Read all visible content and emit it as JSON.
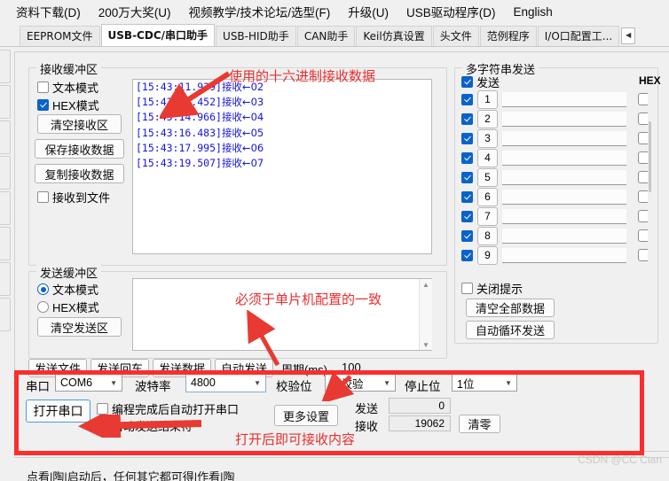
{
  "menubar": {
    "items": [
      {
        "label": "资料下载(D)",
        "accel": "D"
      },
      {
        "label": "200万大奖(U)",
        "accel": "U"
      },
      {
        "label": "视频教学/技术论坛/选型(F)",
        "accel": "F"
      },
      {
        "label": "升级(U)",
        "accel": "U"
      },
      {
        "label": "USB驱动程序(D)",
        "accel": "D"
      },
      {
        "label": "English",
        "accel": "E"
      }
    ]
  },
  "tabs": {
    "items": [
      {
        "label": "EEPROM文件",
        "active": false
      },
      {
        "label": "USB-CDC/串口助手",
        "active": true
      },
      {
        "label": "USB-HID助手",
        "active": false
      },
      {
        "label": "CAN助手",
        "active": false
      },
      {
        "label": "Keil仿真设置",
        "active": false
      },
      {
        "label": "头文件",
        "active": false
      },
      {
        "label": "范例程序",
        "active": false
      },
      {
        "label": "I/O口配置工...",
        "active": false
      }
    ],
    "overflow_arrow": "◀"
  },
  "receive_group": {
    "title": "接收缓冲区",
    "text_mode_label": "文本模式",
    "text_mode_checked": false,
    "hex_mode_label": "HEX模式",
    "hex_mode_checked": true,
    "clear_button": "清空接收区",
    "save_button": "保存接收数据",
    "copy_button": "复制接收数据",
    "to_file_label": "接收到文件",
    "to_file_checked": false,
    "log_lines": [
      {
        "ts": "[15:43:11.939]",
        "text": "接收←02"
      },
      {
        "ts": "[15:43:13.452]",
        "text": "接收←03"
      },
      {
        "ts": "[15:43:14.966]",
        "text": "接收←04"
      },
      {
        "ts": "[15:43:16.483]",
        "text": "接收←05"
      },
      {
        "ts": "[15:43:17.995]",
        "text": "接收←06"
      },
      {
        "ts": "[15:43:19.507]",
        "text": "接收←07"
      }
    ]
  },
  "send_group": {
    "title": "发送缓冲区",
    "text_mode_label": "文本模式",
    "text_mode_checked": true,
    "hex_mode_label": "HEX模式",
    "hex_mode_checked": false,
    "clear_button": "清空发送区",
    "send_value": "",
    "buttons": [
      "发送文件",
      "发送回车",
      "发送数据",
      "自动发送"
    ],
    "period_label": "周期(ms)",
    "period_value": "100"
  },
  "multi_send": {
    "title": "多字符串发送",
    "send_header": "发送",
    "hex_header": "HEX",
    "header_checked": true,
    "rows": [
      {
        "num": "1",
        "checked": true,
        "value": "",
        "hex": false
      },
      {
        "num": "2",
        "checked": true,
        "value": "",
        "hex": false
      },
      {
        "num": "3",
        "checked": true,
        "value": "",
        "hex": false
      },
      {
        "num": "4",
        "checked": true,
        "value": "",
        "hex": false
      },
      {
        "num": "5",
        "checked": true,
        "value": "",
        "hex": false
      },
      {
        "num": "6",
        "checked": true,
        "value": "",
        "hex": false
      },
      {
        "num": "7",
        "checked": true,
        "value": "",
        "hex": false
      },
      {
        "num": "8",
        "checked": true,
        "value": "",
        "hex": false
      },
      {
        "num": "9",
        "checked": true,
        "value": "",
        "hex": false
      }
    ],
    "close_tip_label": "关闭提示",
    "close_tip_checked": false,
    "clear_all_button": "清空全部数据",
    "auto_loop_button": "自动循环发送"
  },
  "serial_bar": {
    "port_label": "串口",
    "port_value": "COM6",
    "baud_label": "波特率",
    "baud_value": "4800",
    "parity_label": "校验位",
    "parity_value": "无校验",
    "stop_label": "停止位",
    "stop_value": "1位",
    "open_button": "打开串口",
    "auto_open_label": "编程完成后自动打开串口",
    "auto_open_checked": false,
    "auto_end_label": "自动发送结束符",
    "auto_end_checked": false,
    "more_settings_button": "更多设置",
    "tx_label": "发送",
    "tx_value": "0",
    "rx_label": "接收",
    "rx_value": "19062",
    "reset_button": "清零"
  },
  "annotations": [
    {
      "id": "a1",
      "text": "使用的十六进制接收数据"
    },
    {
      "id": "a2",
      "text": "必须于单片机配置的一致"
    },
    {
      "id": "a3",
      "text": "打开后即可接收内容"
    }
  ],
  "watermark": "CSDN @CC Cian",
  "statusbar": {
    "text": "点看|陶|启动后，任何其它都可得|作看|陶"
  },
  "colors": {
    "accent": "#0a63c9",
    "annotation_red": "#ea2f2f",
    "highlight_box": "#fb2d2d",
    "log_text": "#1414e0"
  }
}
